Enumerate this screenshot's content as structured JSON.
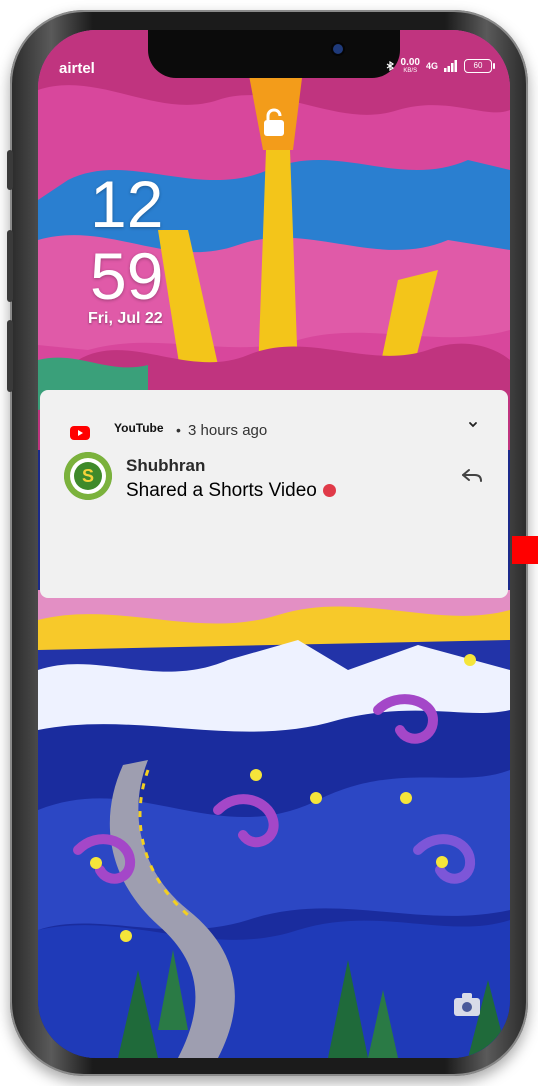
{
  "status_bar": {
    "carrier": "airtel",
    "net_speed_value": "0.00",
    "net_speed_unit": "KB/S",
    "network_type": "4G",
    "battery_level": "60"
  },
  "lock_screen": {
    "hour": "12",
    "minute": "59",
    "date": "Fri, Jul 22"
  },
  "notification": {
    "app_name": "YouTube",
    "separator": "•",
    "time_ago": "3 hours ago",
    "sender": "Shubhran",
    "message": "Shared a Shorts Video",
    "avatar_letter": "S"
  },
  "colors": {
    "youtube_red": "#ff0000",
    "notification_bg": "#f1f1f1",
    "recording_dot": "#e03a48"
  },
  "icons": {
    "lock": "lock-icon",
    "youtube": "youtube-icon",
    "expand": "chevron-down-icon",
    "reply": "reply-icon",
    "camera": "camera-icon"
  }
}
